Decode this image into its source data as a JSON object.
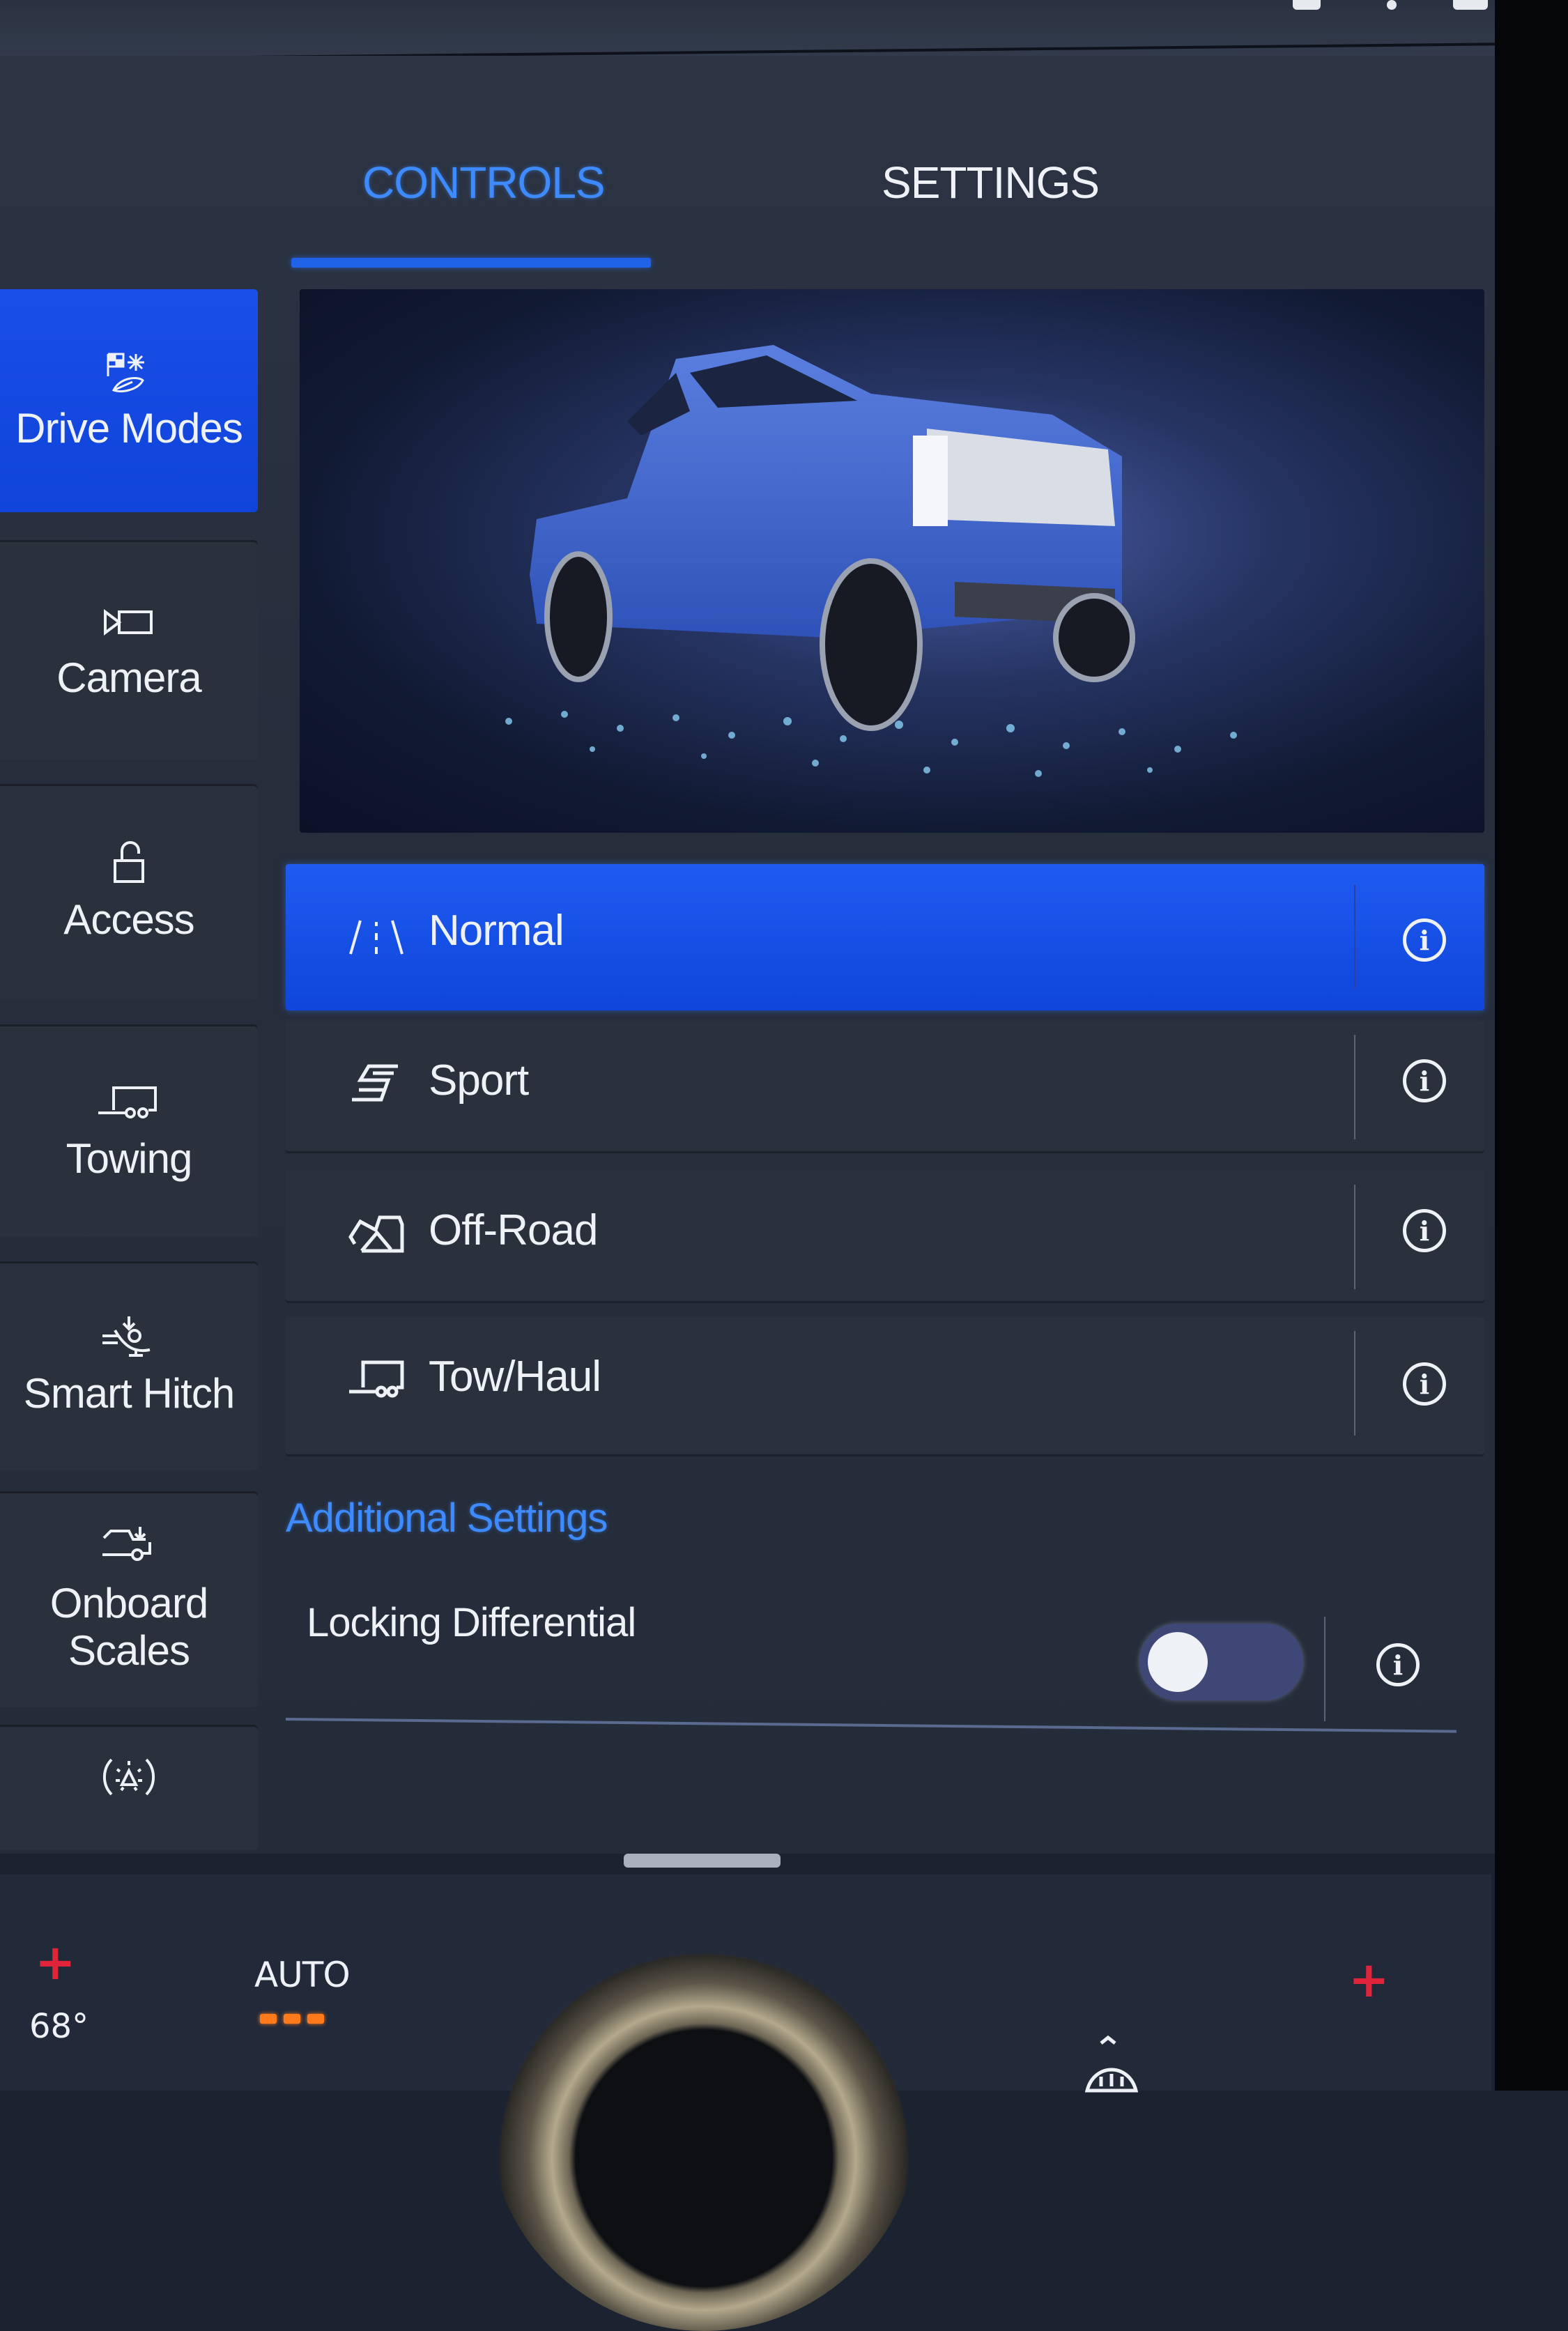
{
  "tabs": [
    {
      "label": "CONTROLS",
      "active": true
    },
    {
      "label": "SETTINGS",
      "active": false
    }
  ],
  "sidebar": {
    "items": [
      {
        "label": "Drive Modes",
        "icon": "drive-modes-icon",
        "active": true
      },
      {
        "label": "Camera",
        "icon": "camera-icon",
        "active": false
      },
      {
        "label": "Access",
        "icon": "unlock-icon",
        "active": false
      },
      {
        "label": "Towing",
        "icon": "trailer-icon",
        "active": false
      },
      {
        "label": "Smart Hitch",
        "icon": "smart-hitch-icon",
        "active": false
      },
      {
        "label": "Onboard Scales",
        "icon": "onboard-scales-icon",
        "active": false
      },
      {
        "label": "",
        "icon": "lighting-icon",
        "active": false
      }
    ]
  },
  "hero": {
    "alt": "Blue pickup truck illustration"
  },
  "drive_modes": [
    {
      "label": "Normal",
      "icon": "normal-road-icon",
      "selected": true
    },
    {
      "label": "Sport",
      "icon": "sport-s-icon",
      "selected": false
    },
    {
      "label": "Off-Road",
      "icon": "off-road-mountain-icon",
      "selected": false
    },
    {
      "label": "Tow/Haul",
      "icon": "tow-haul-trailer-icon",
      "selected": false
    }
  ],
  "additional_settings": {
    "heading": "Additional Settings",
    "items": [
      {
        "label": "Locking Differential",
        "enabled": false
      }
    ]
  },
  "climate": {
    "driver_temp": "68°",
    "fan_mode": "AUTO",
    "fan_level_bars": 3,
    "plus_symbol": "+"
  },
  "colors": {
    "accent_blue": "#1f5bf0",
    "tab_active": "#3d8bff",
    "temp_plus": "#e0243a",
    "fan_indicator": "#ff7a1a"
  }
}
